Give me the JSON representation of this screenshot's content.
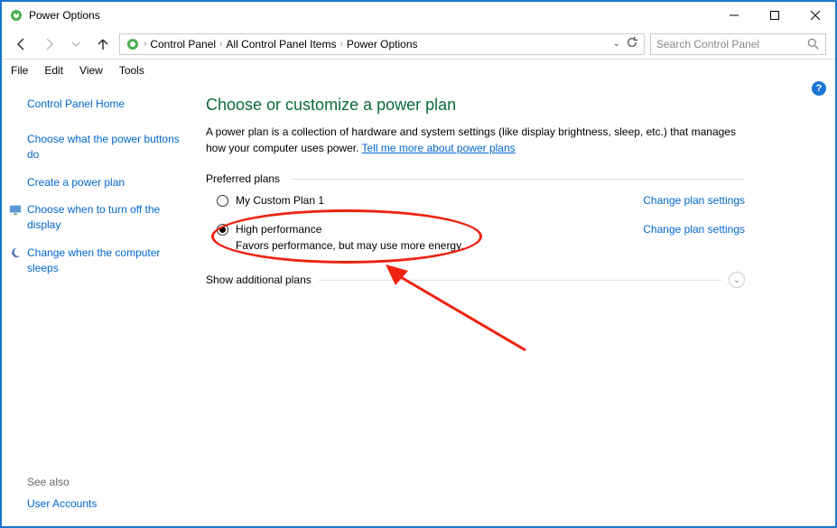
{
  "window": {
    "title": "Power Options"
  },
  "breadcrumb": {
    "items": [
      "Control Panel",
      "All Control Panel Items",
      "Power Options"
    ]
  },
  "search": {
    "placeholder": "Search Control Panel"
  },
  "menu": {
    "file": "File",
    "edit": "Edit",
    "view": "View",
    "tools": "Tools"
  },
  "sidebar": {
    "home": "Control Panel Home",
    "tasks": {
      "t0": "Choose what the power buttons do",
      "t1": "Create a power plan",
      "t2": "Choose when to turn off the display",
      "t3": "Change when the computer sleeps"
    },
    "seealso_label": "See also",
    "seealso_link": "User Accounts"
  },
  "main": {
    "heading": "Choose or customize a power plan",
    "description_a": "A power plan is a collection of hardware and system settings (like display brightness, sleep, etc.) that manages how your computer uses power. ",
    "description_link": "Tell me more about power plans",
    "preferred_label": "Preferred plans",
    "change_link": "Change plan settings",
    "plans": [
      {
        "name": "My Custom Plan 1",
        "desc": "",
        "selected": false
      },
      {
        "name": "High performance",
        "desc": "Favors performance, but may use more energy.",
        "selected": true
      }
    ],
    "show_additional": "Show additional plans"
  },
  "help_icon_char": "?"
}
